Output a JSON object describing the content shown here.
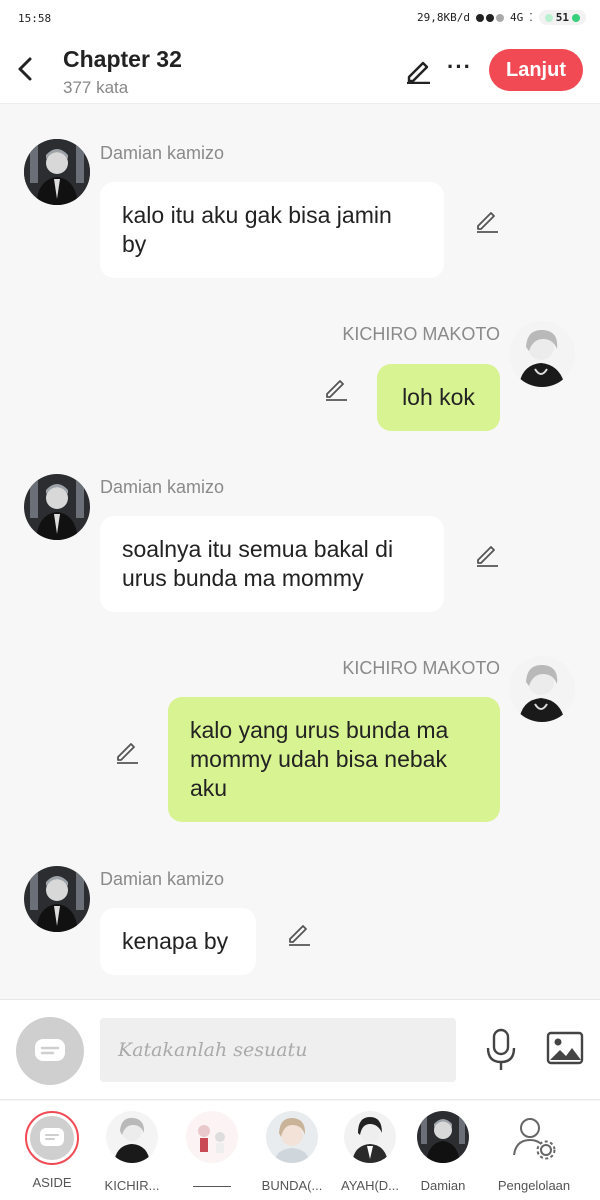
{
  "status_bar": {
    "time": "15:58",
    "speed": "29,8KB/d",
    "network": "4G",
    "battery": "51"
  },
  "header": {
    "title": "Chapter 32",
    "word_count": "377 kata",
    "next_button": "Lanjut"
  },
  "messages": [
    {
      "side": "left",
      "sender": "Damian kamizo",
      "text": "kalo itu aku gak bisa jamin by"
    },
    {
      "side": "right",
      "sender": "KICHIRO MAKOTO",
      "text": "loh kok"
    },
    {
      "side": "left",
      "sender": "Damian kamizo",
      "text": "soalnya itu semua bakal di urus bunda ma mommy"
    },
    {
      "side": "right",
      "sender": "KICHIRO MAKOTO",
      "text": "kalo yang urus bunda ma mommy udah bisa nebak aku"
    },
    {
      "side": "left",
      "sender": "Damian kamizo",
      "text": "kenapa by"
    }
  ],
  "composer": {
    "placeholder": "Katakanlah sesuatu"
  },
  "cast_bar": {
    "items": [
      {
        "label": "ASIDE",
        "icon": "narrator-icon"
      },
      {
        "label": "KICHIR...",
        "icon": "avatar-kichiro"
      },
      {
        "label": "",
        "icon": "avatar-blank"
      },
      {
        "label": "BUNDA(...",
        "icon": "avatar-bunda"
      },
      {
        "label": "AYAH(D...",
        "icon": "avatar-ayah"
      },
      {
        "label": "Damian",
        "icon": "avatar-damian"
      },
      {
        "label": "Pengelolaan",
        "icon": "manage-icon"
      }
    ]
  },
  "colors": {
    "accent": "#f24a55",
    "bubble_right": "#d8f392",
    "bubble_left": "#ffffff",
    "background": "#f7f7f7"
  }
}
